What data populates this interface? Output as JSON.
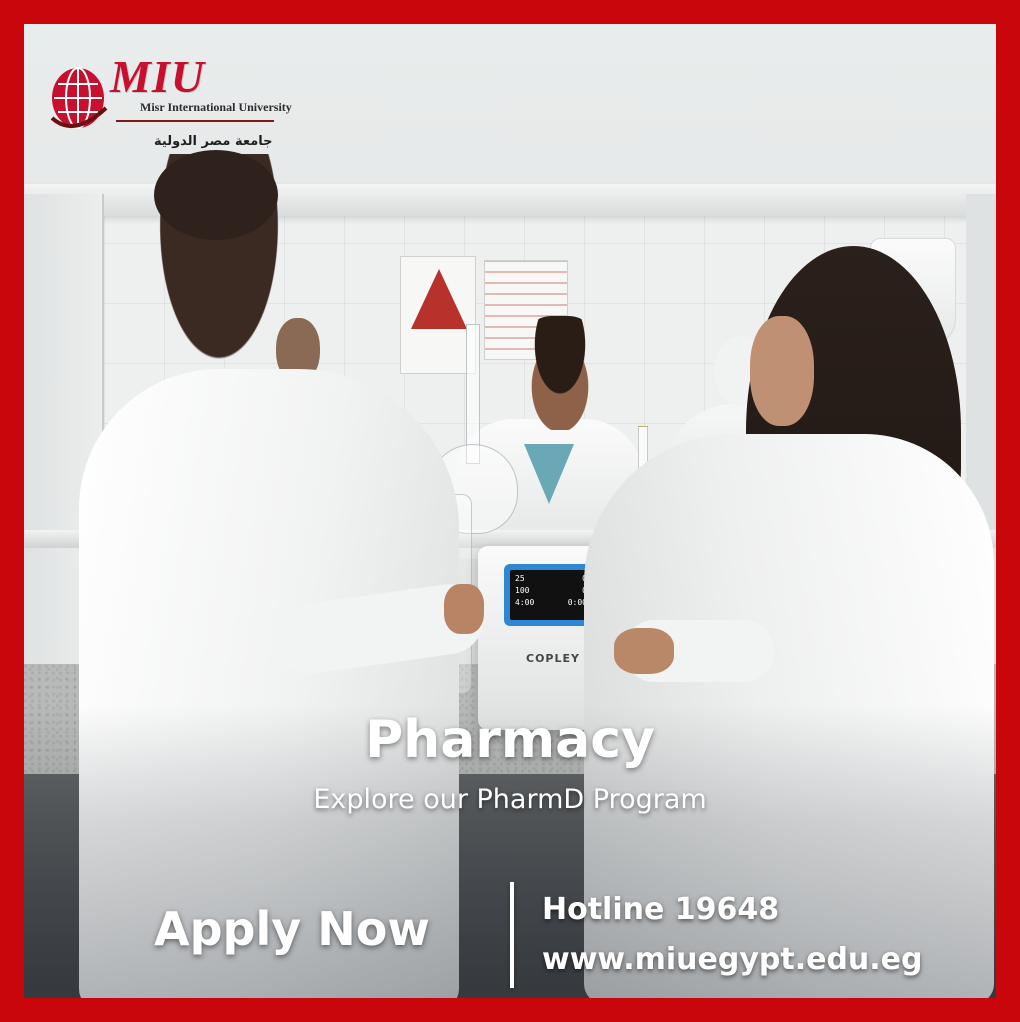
{
  "brand": {
    "wordmark": "MIU",
    "name_en": "Misr International University",
    "name_ar": "جامعة مصر الدولية",
    "primary_color": "#c8060c",
    "accent_color": "#c8102e"
  },
  "hero": {
    "title": "Pharmacy",
    "subtitle": "Explore our PharmD Program"
  },
  "cta": {
    "apply_label": "Apply Now"
  },
  "contact": {
    "hotline": "Hotline 19648",
    "website": "www.miuegypt.edu.eg"
  },
  "device": {
    "brand": "COPLEY",
    "screen": {
      "row1": [
        "25",
        "0"
      ],
      "row2": [
        "100",
        "0"
      ],
      "row3": [
        "4:00",
        "0:00"
      ]
    }
  },
  "icons": [
    "globe-logo-icon"
  ]
}
